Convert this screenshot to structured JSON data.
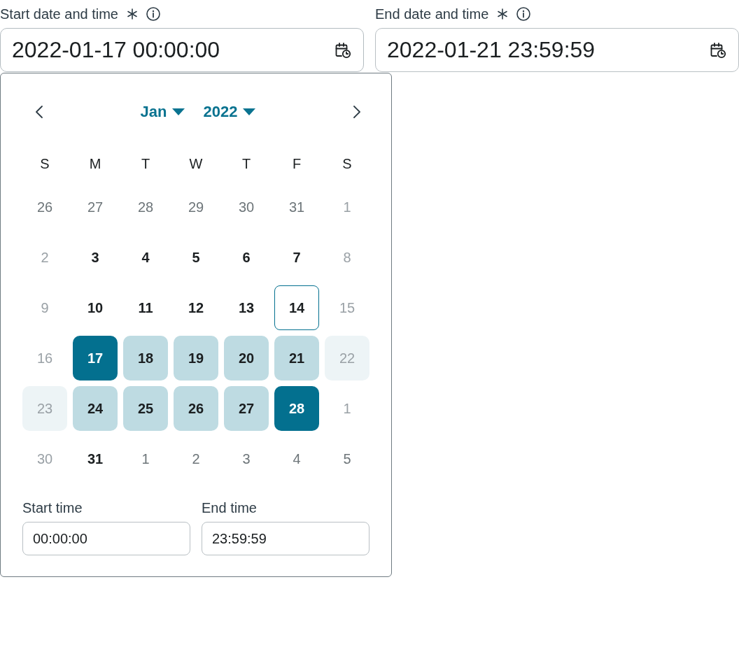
{
  "fields": [
    {
      "label": "Start date and time",
      "required": true,
      "value": "2022-01-17 00:00:00",
      "open": true
    },
    {
      "label": "End date and time",
      "required": true,
      "value": "2022-01-21 23:59:59",
      "open": false
    }
  ],
  "date_picker": {
    "month": "Jan",
    "year": "2022",
    "weekdays": [
      "S",
      "M",
      "T",
      "W",
      "T",
      "F",
      "S"
    ],
    "weeks": [
      [
        {
          "day": "26",
          "kind": "adjacent",
          "selected": false,
          "in_range": false,
          "today": false
        },
        {
          "day": "27",
          "kind": "adjacent",
          "selected": false,
          "in_range": false,
          "today": false
        },
        {
          "day": "28",
          "kind": "adjacent",
          "selected": false,
          "in_range": false,
          "today": false
        },
        {
          "day": "29",
          "kind": "adjacent",
          "selected": false,
          "in_range": false,
          "today": false
        },
        {
          "day": "30",
          "kind": "adjacent",
          "selected": false,
          "in_range": false,
          "today": false
        },
        {
          "day": "31",
          "kind": "adjacent",
          "selected": false,
          "in_range": false,
          "today": false
        },
        {
          "day": "1",
          "kind": "disabled",
          "selected": false,
          "in_range": false,
          "today": false
        }
      ],
      [
        {
          "day": "2",
          "kind": "disabled",
          "selected": false,
          "in_range": false,
          "today": false
        },
        {
          "day": "3",
          "kind": "current",
          "selected": false,
          "in_range": false,
          "today": false
        },
        {
          "day": "4",
          "kind": "current",
          "selected": false,
          "in_range": false,
          "today": false
        },
        {
          "day": "5",
          "kind": "current",
          "selected": false,
          "in_range": false,
          "today": false
        },
        {
          "day": "6",
          "kind": "current",
          "selected": false,
          "in_range": false,
          "today": false
        },
        {
          "day": "7",
          "kind": "current",
          "selected": false,
          "in_range": false,
          "today": false
        },
        {
          "day": "8",
          "kind": "disabled",
          "selected": false,
          "in_range": false,
          "today": false
        }
      ],
      [
        {
          "day": "9",
          "kind": "disabled",
          "selected": false,
          "in_range": false,
          "today": false
        },
        {
          "day": "10",
          "kind": "current",
          "selected": false,
          "in_range": false,
          "today": false
        },
        {
          "day": "11",
          "kind": "current",
          "selected": false,
          "in_range": false,
          "today": false
        },
        {
          "day": "12",
          "kind": "current",
          "selected": false,
          "in_range": false,
          "today": false
        },
        {
          "day": "13",
          "kind": "current",
          "selected": false,
          "in_range": false,
          "today": false
        },
        {
          "day": "14",
          "kind": "current",
          "selected": false,
          "in_range": false,
          "today": true
        },
        {
          "day": "15",
          "kind": "disabled",
          "selected": false,
          "in_range": false,
          "today": false
        }
      ],
      [
        {
          "day": "16",
          "kind": "disabled",
          "selected": false,
          "in_range": false,
          "today": false
        },
        {
          "day": "17",
          "kind": "current",
          "selected": true,
          "in_range": true,
          "today": false
        },
        {
          "day": "18",
          "kind": "current",
          "selected": false,
          "in_range": true,
          "today": false
        },
        {
          "day": "19",
          "kind": "current",
          "selected": false,
          "in_range": true,
          "today": false
        },
        {
          "day": "20",
          "kind": "current",
          "selected": false,
          "in_range": true,
          "today": false
        },
        {
          "day": "21",
          "kind": "current",
          "selected": false,
          "in_range": true,
          "today": false
        },
        {
          "day": "22",
          "kind": "disabled",
          "selected": false,
          "in_range": true,
          "today": false
        }
      ],
      [
        {
          "day": "23",
          "kind": "disabled",
          "selected": false,
          "in_range": true,
          "today": false
        },
        {
          "day": "24",
          "kind": "current",
          "selected": false,
          "in_range": true,
          "today": false
        },
        {
          "day": "25",
          "kind": "current",
          "selected": false,
          "in_range": true,
          "today": false
        },
        {
          "day": "26",
          "kind": "current",
          "selected": false,
          "in_range": true,
          "today": false
        },
        {
          "day": "27",
          "kind": "current",
          "selected": false,
          "in_range": true,
          "today": false
        },
        {
          "day": "28",
          "kind": "current",
          "selected": true,
          "in_range": true,
          "today": false
        },
        {
          "day": "1",
          "kind": "disabled",
          "selected": false,
          "in_range": false,
          "today": false
        }
      ],
      [
        {
          "day": "30",
          "kind": "disabled",
          "selected": false,
          "in_range": false,
          "today": false
        },
        {
          "day": "31",
          "kind": "current",
          "selected": false,
          "in_range": false,
          "today": false
        },
        {
          "day": "1",
          "kind": "adjacent",
          "selected": false,
          "in_range": false,
          "today": false
        },
        {
          "day": "2",
          "kind": "adjacent",
          "selected": false,
          "in_range": false,
          "today": false
        },
        {
          "day": "3",
          "kind": "adjacent",
          "selected": false,
          "in_range": false,
          "today": false
        },
        {
          "day": "4",
          "kind": "adjacent",
          "selected": false,
          "in_range": false,
          "today": false
        },
        {
          "day": "5",
          "kind": "adjacent",
          "selected": false,
          "in_range": false,
          "today": false
        }
      ]
    ],
    "time_fields": [
      {
        "label": "Start time",
        "value": "00:00:00"
      },
      {
        "label": "End time",
        "value": "23:59:59"
      }
    ]
  }
}
